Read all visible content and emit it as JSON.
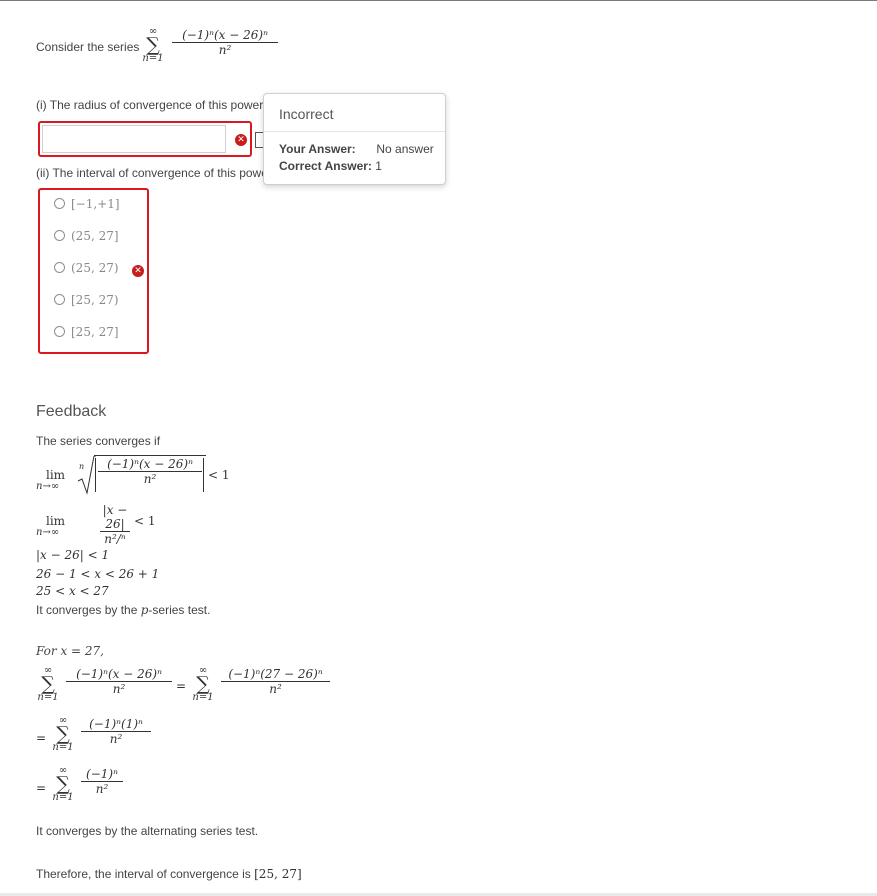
{
  "question": {
    "consider_text": "Consider the series",
    "sum_upper": "∞",
    "sum_lower": "n=1",
    "numerator": "(−1)ⁿ(x − 26)ⁿ",
    "denominator": "n²",
    "part1_label": "(i) The radius of convergence of this power",
    "part1_value": "",
    "part2_label": "(ii) The interval of convergence of this powe",
    "options": [
      "[−1,+1]",
      "(25, 27]",
      "(25, 27)",
      "[25, 27)",
      "[25, 27]"
    ],
    "selected_option_index": 2
  },
  "popup": {
    "title": "Incorrect",
    "your_answer_label": "Your Answer:",
    "your_answer_value": "No answer",
    "correct_answer_label": "Correct Answer:",
    "correct_answer_value": "1"
  },
  "feedback": {
    "title": "Feedback",
    "intro": "The series converges if",
    "lim": "lim",
    "lim_sub": "n→∞",
    "root_index": "n",
    "root_num": "(−1)ⁿ(x − 26)ⁿ",
    "root_den": "n²",
    "lt1": "< 1",
    "step2_num": "|x − 26|",
    "step2_den": "n²/ⁿ",
    "step3": "|x − 26| < 1",
    "step4": "26 − 1 < x < 26 + 1",
    "step5": "25 < x < 27",
    "pseries_prefix": "It converges by the ",
    "pseries_p": "p",
    "pseries_suffix": "-series test.",
    "for_text": "For x = 27,",
    "eq1_num": "(−1)ⁿ(x − 26)ⁿ",
    "eq1_den": "n²",
    "eq1_rhs_num": "(−1)ⁿ(27 − 26)ⁿ",
    "eq1_rhs_den": "n²",
    "eq2_num": "(−1)ⁿ(1)ⁿ",
    "eq2_den": "n²",
    "eq3_num": "(−1)ⁿ",
    "eq3_den": "n²",
    "equals": "=",
    "alt_text": "It converges by the alternating series test.",
    "therefore_text": "Therefore, the interval of convergence is ",
    "final_interval": "[25, 27]"
  },
  "colors": {
    "error_red": "#d9191d",
    "icon_red": "#c81d1d",
    "text": "#444444"
  },
  "icons": {
    "error": "x-circle-icon"
  }
}
